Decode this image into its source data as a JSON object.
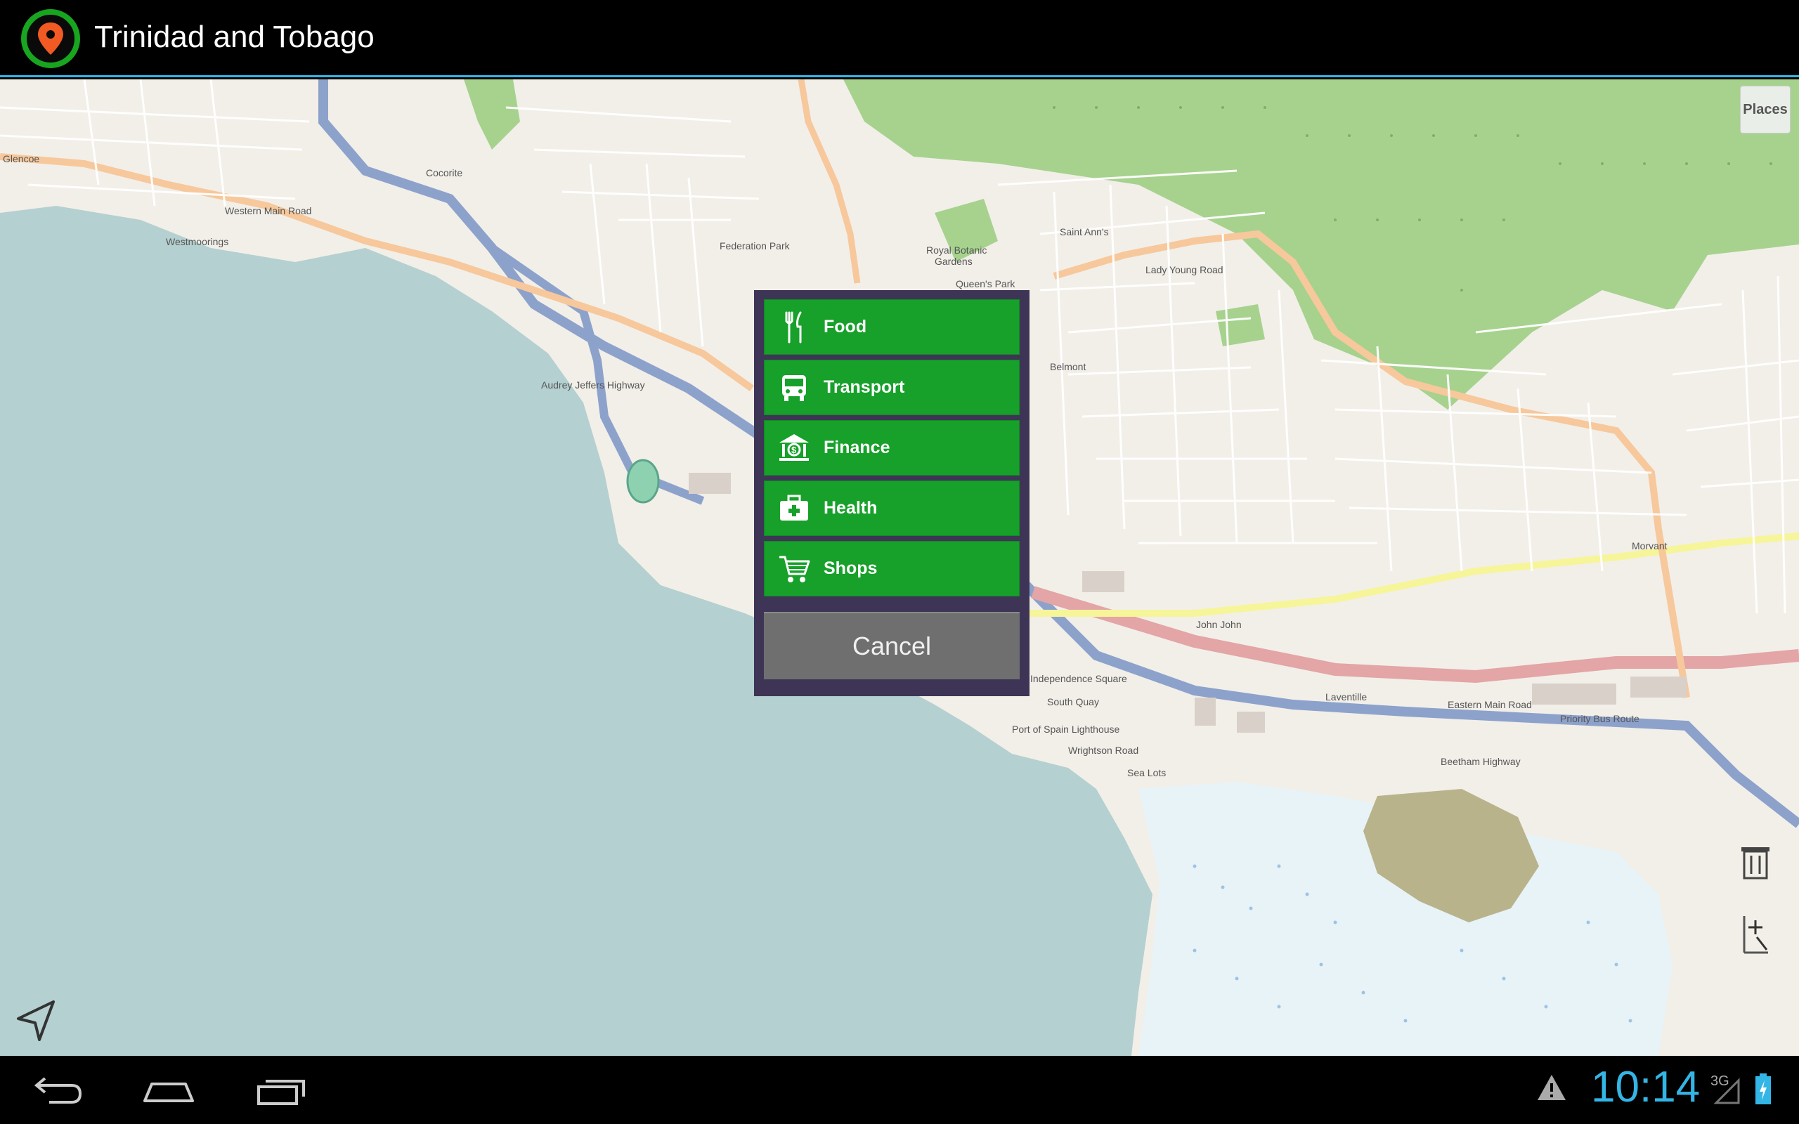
{
  "app": {
    "title": "Trinidad and Tobago"
  },
  "map": {
    "places_label": "Places",
    "labels": [
      "Glencoe",
      "Cocorite",
      "Westmoorings",
      "Federation Park",
      "Royal Botanic Gardens",
      "Saint Ann's",
      "Belmont",
      "Morvant",
      "John John",
      "Laventille",
      "Sea Lots",
      "Independence Square",
      "South Quay",
      "Beetham Highway",
      "Lady Young Road",
      "Western Main Road",
      "Eastern Main Road",
      "Priority Bus Route",
      "Queen's Park",
      "Wrightson Road",
      "Audrey Jeffers Highway",
      "Port of Spain Lighthouse"
    ]
  },
  "menu": {
    "items": [
      {
        "label": "Food",
        "icon": "fork-knife-icon"
      },
      {
        "label": "Transport",
        "icon": "bus-icon"
      },
      {
        "label": "Finance",
        "icon": "bank-icon"
      },
      {
        "label": "Health",
        "icon": "medical-kit-icon"
      },
      {
        "label": "Shops",
        "icon": "shopping-cart-icon"
      }
    ],
    "cancel_label": "Cancel"
  },
  "status": {
    "time": "10:14",
    "network": "3G"
  },
  "colors": {
    "accent": "#33b5e5",
    "menu_green": "#17a02a",
    "dialog_bg": "#3e3556",
    "water": "#b5d0d0",
    "park": "#8fce72"
  }
}
